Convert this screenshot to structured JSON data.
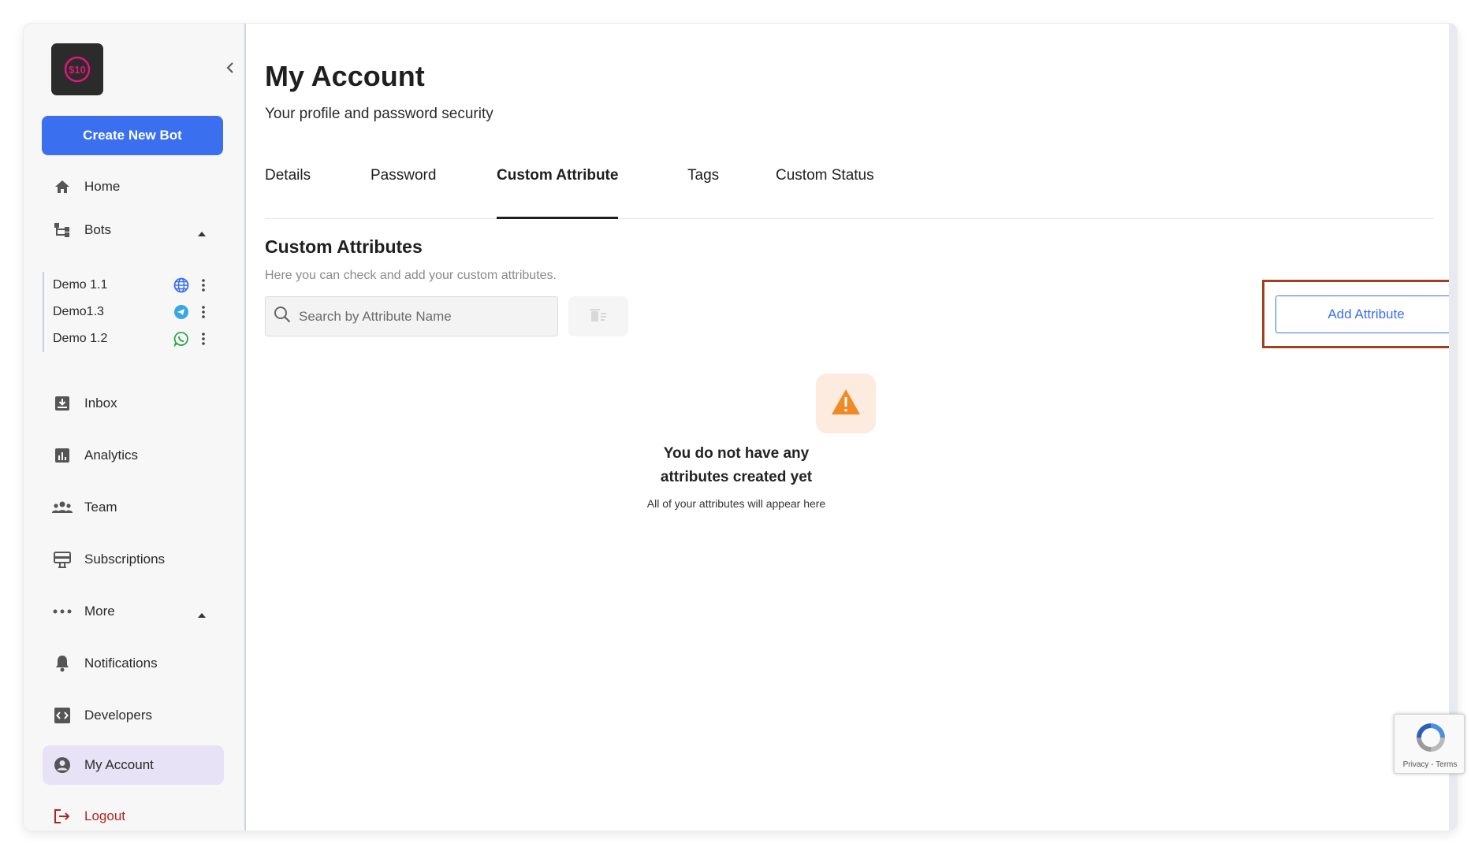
{
  "sidebar": {
    "create_label": "Create New Bot",
    "nav": {
      "home": "Home",
      "bots": "Bots",
      "inbox": "Inbox",
      "analytics": "Analytics",
      "team": "Team",
      "subscriptions": "Subscriptions",
      "more": "More",
      "notifications": "Notifications",
      "developers": "Developers",
      "my_account": "My Account",
      "logout": "Logout"
    },
    "bots": [
      {
        "name": "Demo 1.1",
        "channel": "globe-icon"
      },
      {
        "name": "Demo1.3",
        "channel": "telegram-icon"
      },
      {
        "name": "Demo 1.2",
        "channel": "whatsapp-icon"
      }
    ]
  },
  "header": {
    "title": "My Account",
    "subtitle": "Your profile and password security"
  },
  "tabs": [
    {
      "label": "Details",
      "active": false
    },
    {
      "label": "Password",
      "active": false
    },
    {
      "label": "Custom Attribute",
      "active": true
    },
    {
      "label": "Tags",
      "active": false
    },
    {
      "label": "Custom Status",
      "active": false
    }
  ],
  "section": {
    "title": "Custom Attributes",
    "description": "Here you can check and add your custom attributes.",
    "search_placeholder": "Search by Attribute Name",
    "add_button": "Add Attribute"
  },
  "empty_state": {
    "title_line1": "You do not have any",
    "title_line2": "attributes created yet",
    "subtitle": "All of your attributes will appear here"
  },
  "recaptcha": {
    "text": "Privacy - Terms"
  },
  "colors": {
    "primary": "#3a6ff0",
    "active_nav_bg": "#e7e2f6",
    "logout": "#b5231f",
    "warning": "#f08a24",
    "highlight_border": "#a2401d"
  }
}
